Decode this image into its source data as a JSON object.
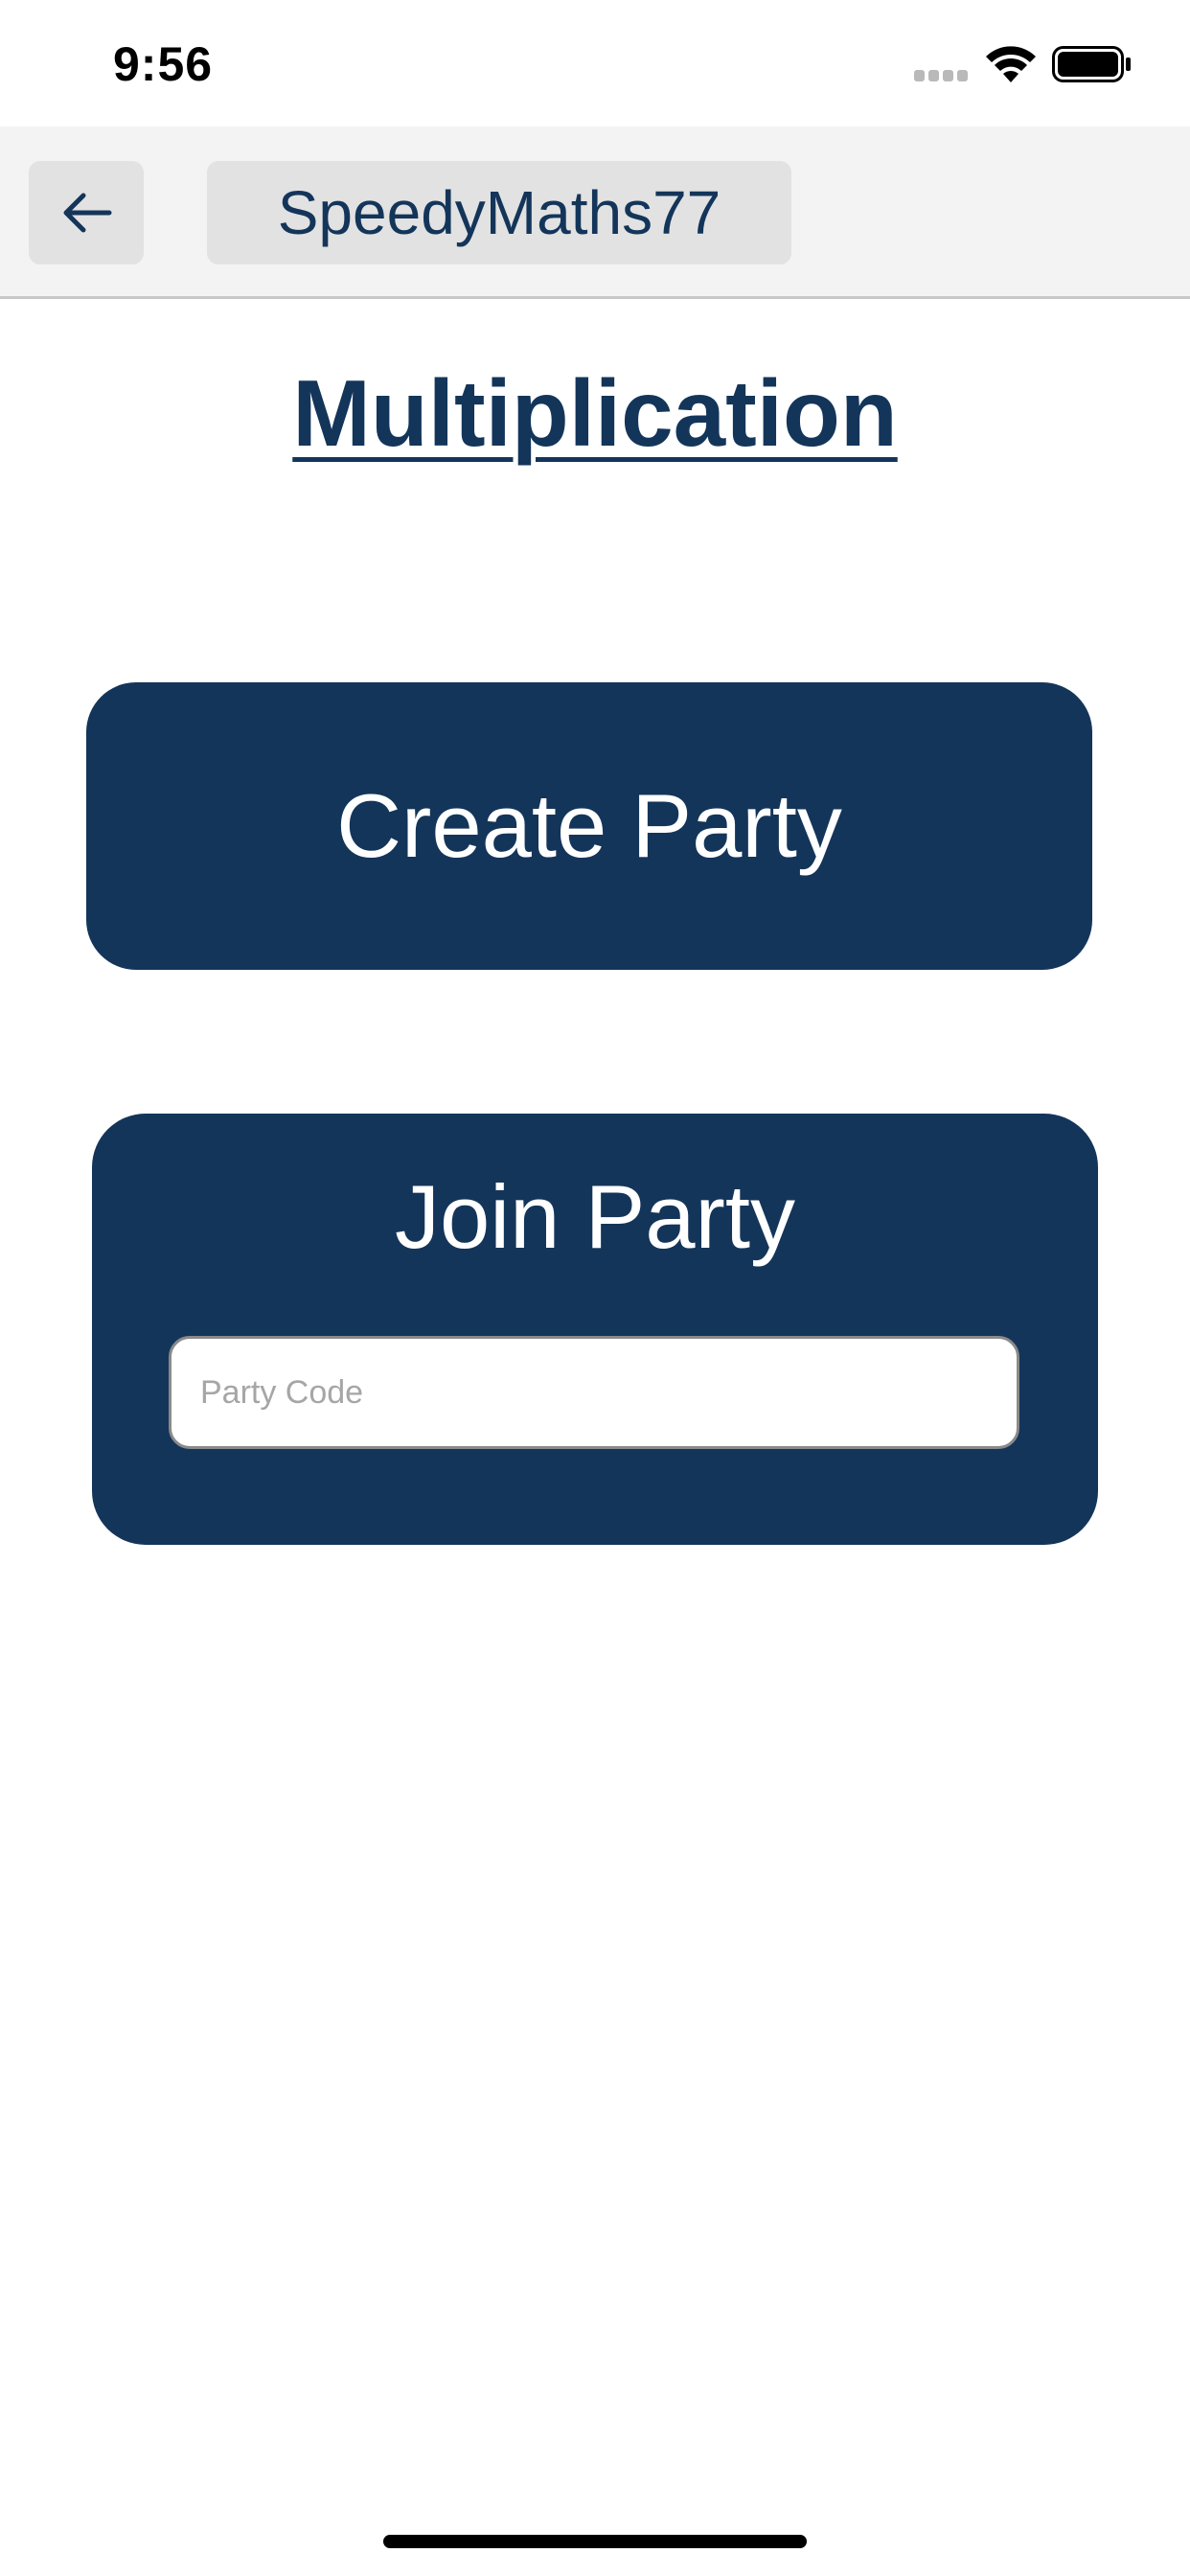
{
  "status_bar": {
    "time": "9:56"
  },
  "header": {
    "back_icon": "arrow-left-icon",
    "username": "SpeedyMaths77"
  },
  "main": {
    "title": "Multiplication",
    "create_party_label": "Create Party",
    "join_party": {
      "title": "Join Party",
      "input_placeholder": "Party Code",
      "input_value": ""
    }
  },
  "colors": {
    "primary": "#14355a",
    "header_bg": "#f3f3f3",
    "chip_bg": "#e2e2e2"
  }
}
